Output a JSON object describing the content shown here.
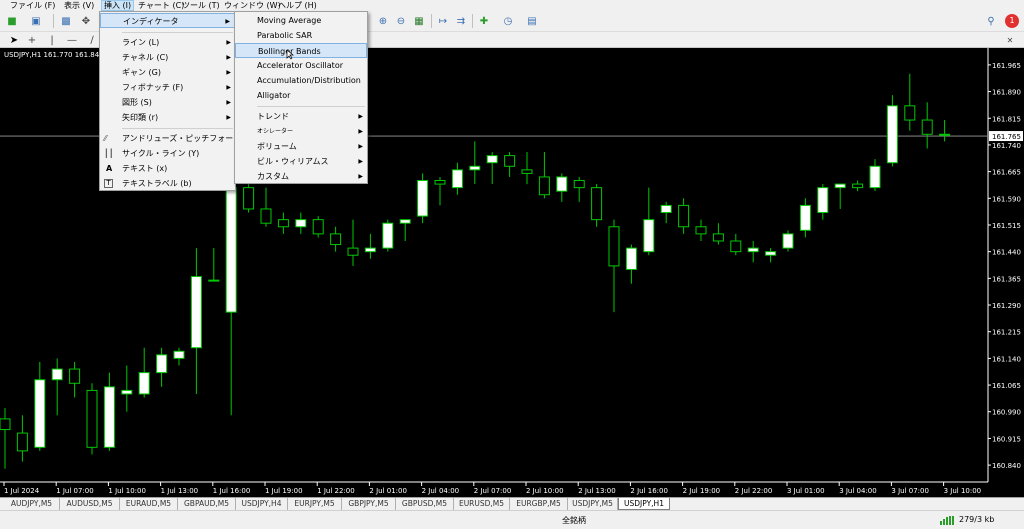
{
  "menubar": {
    "items": [
      {
        "label": "ファイル (F)"
      },
      {
        "label": "表示 (V)"
      },
      {
        "label": "挿入 (I)"
      },
      {
        "label": "チャート (C)"
      },
      {
        "label": "ツール (T)"
      },
      {
        "label": "ウィンドウ (W)"
      },
      {
        "label": "ヘルプ (H)"
      }
    ]
  },
  "toolbar": {
    "notification_count": "1"
  },
  "chart": {
    "title": "USDJPY,H1  161.770 161.84",
    "current_price": "161.765",
    "price_labels": [
      "161.965",
      "161.890",
      "161.815",
      "161.740",
      "161.665",
      "161.590",
      "161.515",
      "161.440",
      "161.365",
      "161.290",
      "161.215",
      "161.140",
      "161.065",
      "160.990",
      "160.915",
      "160.840"
    ],
    "time_labels": [
      "1 Jul 2024",
      "1 Jul 07:00",
      "1 Jul 10:00",
      "1 Jul 13:00",
      "1 Jul 16:00",
      "1 Jul 19:00",
      "1 Jul 22:00",
      "2 Jul 01:00",
      "2 Jul 04:00",
      "2 Jul 07:00",
      "2 Jul 10:00",
      "2 Jul 13:00",
      "2 Jul 16:00",
      "2 Jul 19:00",
      "2 Jul 22:00",
      "3 Jul 01:00",
      "3 Jul 04:00",
      "3 Jul 07:00",
      "3 Jul 10:00"
    ],
    "up_color": "#ffffff",
    "down_color": "#000000",
    "wick_color": "#00c800",
    "background": "#000000"
  },
  "chart_data": {
    "type": "candlestick",
    "symbol": "USDJPY",
    "timeframe": "H1",
    "ylim": [
      160.815,
      161.99
    ],
    "candles": [
      {
        "o": 160.97,
        "h": 161.0,
        "l": 160.83,
        "c": 160.94
      },
      {
        "o": 160.93,
        "h": 160.98,
        "l": 160.85,
        "c": 160.88
      },
      {
        "o": 160.89,
        "h": 161.13,
        "l": 160.88,
        "c": 161.08
      },
      {
        "o": 161.08,
        "h": 161.14,
        "l": 160.98,
        "c": 161.11
      },
      {
        "o": 161.11,
        "h": 161.13,
        "l": 161.03,
        "c": 161.07
      },
      {
        "o": 161.05,
        "h": 161.07,
        "l": 160.87,
        "c": 160.89
      },
      {
        "o": 160.89,
        "h": 161.1,
        "l": 160.88,
        "c": 161.06
      },
      {
        "o": 161.04,
        "h": 161.12,
        "l": 160.99,
        "c": 161.05
      },
      {
        "o": 161.04,
        "h": 161.17,
        "l": 161.03,
        "c": 161.1
      },
      {
        "o": 161.1,
        "h": 161.17,
        "l": 161.06,
        "c": 161.15
      },
      {
        "o": 161.14,
        "h": 161.17,
        "l": 161.12,
        "c": 161.16
      },
      {
        "o": 161.17,
        "h": 161.45,
        "l": 161.04,
        "c": 161.37
      },
      {
        "o": 161.36,
        "h": 161.45,
        "l": 161.36,
        "c": 161.36
      },
      {
        "o": 161.27,
        "h": 161.7,
        "l": 160.98,
        "c": 161.62
      },
      {
        "o": 161.62,
        "h": 161.72,
        "l": 161.55,
        "c": 161.56
      },
      {
        "o": 161.56,
        "h": 161.62,
        "l": 161.51,
        "c": 161.52
      },
      {
        "o": 161.53,
        "h": 161.55,
        "l": 161.49,
        "c": 161.51
      },
      {
        "o": 161.51,
        "h": 161.55,
        "l": 161.49,
        "c": 161.53
      },
      {
        "o": 161.53,
        "h": 161.54,
        "l": 161.48,
        "c": 161.49
      },
      {
        "o": 161.49,
        "h": 161.51,
        "l": 161.44,
        "c": 161.46
      },
      {
        "o": 161.45,
        "h": 161.53,
        "l": 161.4,
        "c": 161.43
      },
      {
        "o": 161.44,
        "h": 161.49,
        "l": 161.42,
        "c": 161.45
      },
      {
        "o": 161.45,
        "h": 161.53,
        "l": 161.44,
        "c": 161.52
      },
      {
        "o": 161.52,
        "h": 161.53,
        "l": 161.47,
        "c": 161.53
      },
      {
        "o": 161.54,
        "h": 161.66,
        "l": 161.52,
        "c": 161.64
      },
      {
        "o": 161.64,
        "h": 161.65,
        "l": 161.57,
        "c": 161.63
      },
      {
        "o": 161.62,
        "h": 161.69,
        "l": 161.6,
        "c": 161.67
      },
      {
        "o": 161.67,
        "h": 161.75,
        "l": 161.63,
        "c": 161.68
      },
      {
        "o": 161.69,
        "h": 161.72,
        "l": 161.63,
        "c": 161.71
      },
      {
        "o": 161.71,
        "h": 161.72,
        "l": 161.65,
        "c": 161.68
      },
      {
        "o": 161.67,
        "h": 161.72,
        "l": 161.63,
        "c": 161.66
      },
      {
        "o": 161.65,
        "h": 161.72,
        "l": 161.59,
        "c": 161.6
      },
      {
        "o": 161.61,
        "h": 161.66,
        "l": 161.58,
        "c": 161.65
      },
      {
        "o": 161.64,
        "h": 161.65,
        "l": 161.58,
        "c": 161.62
      },
      {
        "o": 161.62,
        "h": 161.63,
        "l": 161.51,
        "c": 161.53
      },
      {
        "o": 161.51,
        "h": 161.53,
        "l": 161.27,
        "c": 161.4
      },
      {
        "o": 161.39,
        "h": 161.46,
        "l": 161.35,
        "c": 161.45
      },
      {
        "o": 161.44,
        "h": 161.62,
        "l": 161.43,
        "c": 161.53
      },
      {
        "o": 161.55,
        "h": 161.58,
        "l": 161.52,
        "c": 161.57
      },
      {
        "o": 161.57,
        "h": 161.59,
        "l": 161.49,
        "c": 161.51
      },
      {
        "o": 161.51,
        "h": 161.53,
        "l": 161.47,
        "c": 161.49
      },
      {
        "o": 161.49,
        "h": 161.52,
        "l": 161.46,
        "c": 161.47
      },
      {
        "o": 161.47,
        "h": 161.49,
        "l": 161.43,
        "c": 161.44
      },
      {
        "o": 161.44,
        "h": 161.47,
        "l": 161.41,
        "c": 161.45
      },
      {
        "o": 161.43,
        "h": 161.45,
        "l": 161.41,
        "c": 161.44
      },
      {
        "o": 161.45,
        "h": 161.5,
        "l": 161.44,
        "c": 161.49
      },
      {
        "o": 161.5,
        "h": 161.59,
        "l": 161.48,
        "c": 161.57
      },
      {
        "o": 161.55,
        "h": 161.63,
        "l": 161.53,
        "c": 161.62
      },
      {
        "o": 161.62,
        "h": 161.63,
        "l": 161.56,
        "c": 161.63
      },
      {
        "o": 161.63,
        "h": 161.64,
        "l": 161.61,
        "c": 161.62
      },
      {
        "o": 161.62,
        "h": 161.7,
        "l": 161.61,
        "c": 161.68
      },
      {
        "o": 161.69,
        "h": 161.88,
        "l": 161.68,
        "c": 161.85
      },
      {
        "o": 161.85,
        "h": 161.94,
        "l": 161.78,
        "c": 161.81
      },
      {
        "o": 161.81,
        "h": 161.86,
        "l": 161.73,
        "c": 161.77
      },
      {
        "o": 161.77,
        "h": 161.81,
        "l": 161.75,
        "c": 161.77
      }
    ]
  },
  "insert_menu": {
    "items": [
      {
        "label": "インディケータ",
        "has_submenu": true
      },
      {
        "label": "ライン (L)",
        "has_submenu": true
      },
      {
        "label": "チャネル (C)",
        "has_submenu": true
      },
      {
        "label": "ギャン (G)",
        "has_submenu": true
      },
      {
        "label": "フィボナッチ (F)",
        "has_submenu": true
      },
      {
        "label": "図形 (S)",
        "has_submenu": true
      },
      {
        "label": "矢印類 (r)",
        "has_submenu": true
      },
      {
        "label": "アンドリューズ・ピッチフォーク (A)",
        "has_submenu": false
      },
      {
        "label": "サイクル・ライン (Y)",
        "has_submenu": false
      },
      {
        "label": "テキスト (x)",
        "has_submenu": false
      },
      {
        "label": "テキストラベル (b)",
        "has_submenu": false
      }
    ]
  },
  "indicator_menu": {
    "items": [
      {
        "label": "Moving Average"
      },
      {
        "label": "Parabolic SAR"
      },
      {
        "label": "Bollinger Bands"
      },
      {
        "label": "Accelerator Oscillator"
      },
      {
        "label": "Accumulation/Distribution"
      },
      {
        "label": "Alligator"
      },
      {
        "label": "トレンド"
      },
      {
        "label": "オシレーター"
      },
      {
        "label": "ボリューム"
      },
      {
        "label": "ビル・ウィリアムス"
      },
      {
        "label": "カスタム"
      }
    ]
  },
  "tabs": [
    {
      "label": "AUDJPY,M5"
    },
    {
      "label": "AUDUSD,M5"
    },
    {
      "label": "EURAUD,M5"
    },
    {
      "label": "GBPAUD,M5"
    },
    {
      "label": "USDJPY,H4"
    },
    {
      "label": "EURJPY,M5"
    },
    {
      "label": "GBPJPY,M5"
    },
    {
      "label": "GBPUSD,M5"
    },
    {
      "label": "EURUSD,M5"
    },
    {
      "label": "EURGBP,M5"
    },
    {
      "label": "USDJPY,M5"
    },
    {
      "label": "USDJPY,H1"
    }
  ],
  "status": {
    "profile": "全銘柄",
    "traffic": "279/3 kb"
  }
}
